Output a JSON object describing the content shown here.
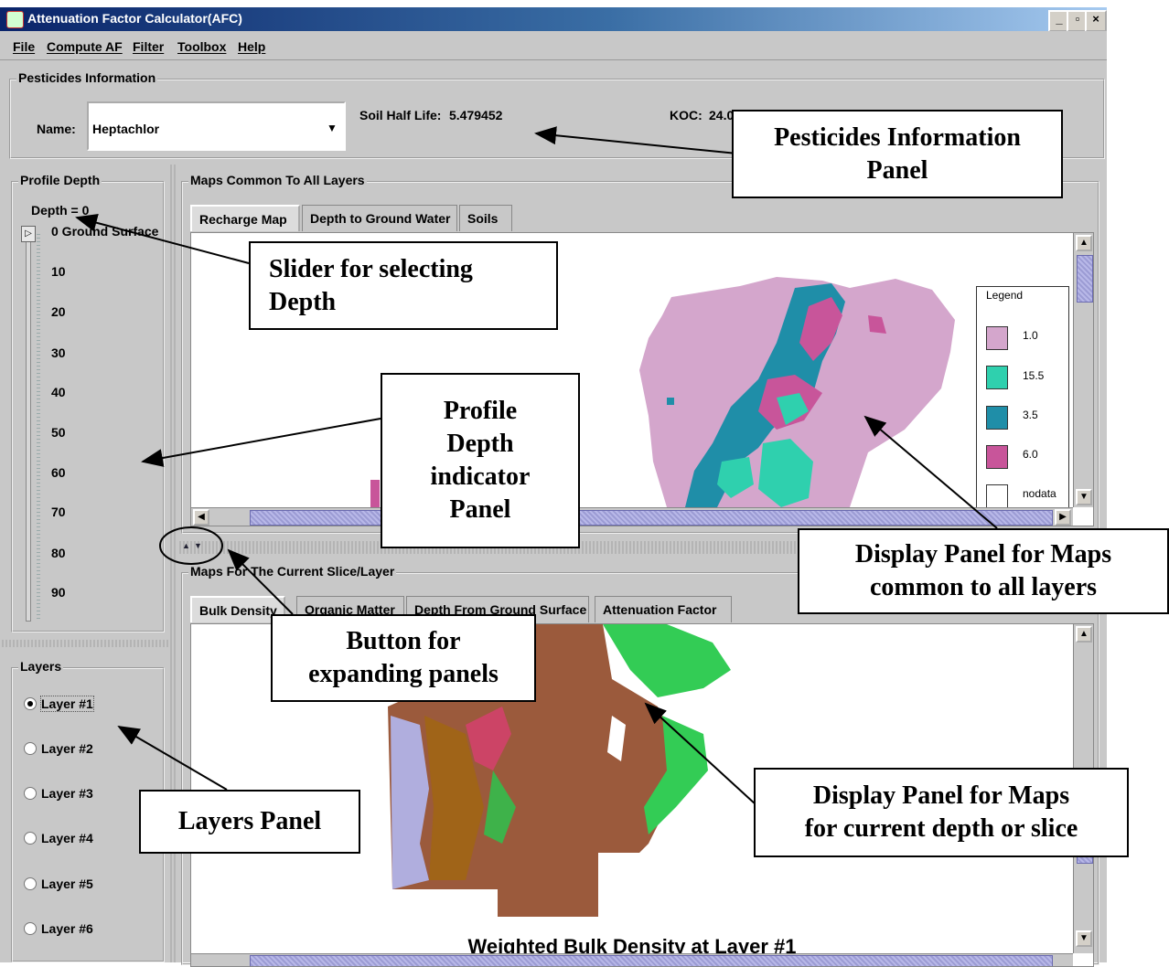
{
  "window": {
    "title": "Attenuation Factor Calculator(AFC)",
    "controls": [
      "_",
      "▫",
      "×"
    ]
  },
  "menubar": [
    "File",
    "Compute AF",
    "Filter",
    "Toolbox",
    "Help"
  ],
  "pesticides": {
    "group_label": "Pesticides Information",
    "name_label": "Name:",
    "name_value": "Heptachlor",
    "half_life_label": "Soil Half Life:",
    "half_life_value": "5.479452",
    "koc_label": "KOC:",
    "koc_value": "24.0"
  },
  "profile": {
    "group_label": "Profile Depth",
    "depth_readout": "Depth = 0",
    "depth_value": 0,
    "ticks": [
      "0 Ground Surface",
      "10",
      "20",
      "30",
      "40",
      "50",
      "60",
      "70",
      "80",
      "90"
    ]
  },
  "layers": {
    "group_label": "Layers",
    "items": [
      "Layer #1",
      "Layer #2",
      "Layer #3",
      "Layer #4",
      "Layer #5",
      "Layer #6"
    ],
    "selected": "Layer #1"
  },
  "maps_common": {
    "group_label": "Maps Common To All Layers",
    "tabs": [
      "Recharge Map",
      "Depth to Ground Water",
      "Soils"
    ],
    "active_tab": "Recharge Map",
    "legend": {
      "title": "Legend",
      "items": [
        {
          "label": "1.0",
          "color": "#d4a6cc"
        },
        {
          "label": "15.5",
          "color": "#2fd0ae"
        },
        {
          "label": "3.5",
          "color": "#1f8ea8"
        },
        {
          "label": "6.0",
          "color": "#c8559a"
        },
        {
          "label": "nodata",
          "color": "#ffffff"
        }
      ]
    }
  },
  "maps_slice": {
    "group_label": "Maps For The Current Slice/Layer",
    "tabs": [
      "Bulk Density",
      "Organic Matter",
      "Depth From Ground Surface",
      "Attenuation Factor"
    ],
    "active_tab": "Bulk Density",
    "map_caption": "Weighted Bulk Density at Layer #1"
  },
  "callouts": {
    "pesticides_panel": [
      "Pesticides Information",
      "Panel"
    ],
    "slider": [
      "Slider for selecting",
      "Depth"
    ],
    "profile_panel": [
      "Profile",
      "Depth",
      "indicator",
      "Panel"
    ],
    "display_common": [
      "Display Panel for Maps",
      "common to all layers"
    ],
    "expand_button": [
      "Button for",
      "expanding panels"
    ],
    "layers_panel": [
      "Layers Panel"
    ],
    "display_slice": [
      "Display Panel for Maps",
      "for current depth or slice"
    ]
  },
  "colors": {
    "titlebar_start": "#0a246a",
    "panel_bg": "#c8c8c8",
    "scroll_thumb": "#9c9cd4"
  }
}
